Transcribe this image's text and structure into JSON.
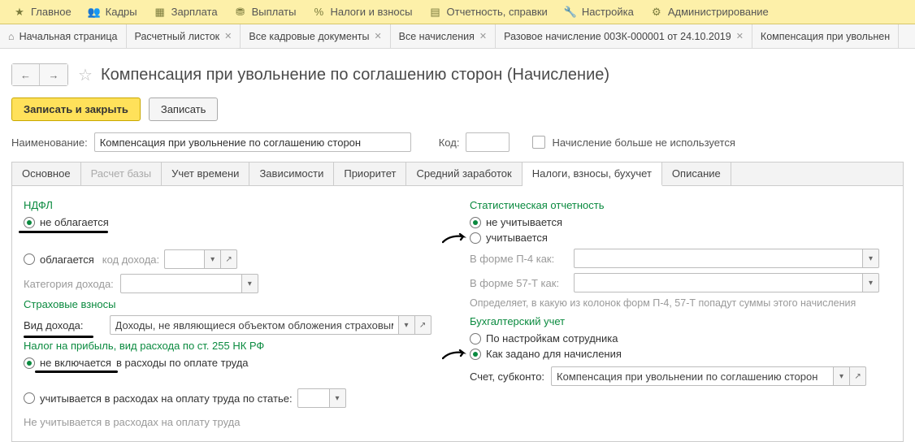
{
  "topmenu": [
    {
      "icon": "star",
      "label": "Главное"
    },
    {
      "icon": "people",
      "label": "Кадры"
    },
    {
      "icon": "calendar",
      "label": "Зарплата"
    },
    {
      "icon": "money",
      "label": "Выплаты"
    },
    {
      "icon": "percent",
      "label": "Налоги и взносы"
    },
    {
      "icon": "doc",
      "label": "Отчетность, справки"
    },
    {
      "icon": "wrench",
      "label": "Настройка"
    },
    {
      "icon": "gear",
      "label": "Администрирование"
    }
  ],
  "tabs_open": [
    {
      "label": "Начальная страница",
      "closable": false,
      "home": true
    },
    {
      "label": "Расчетный листок",
      "closable": true
    },
    {
      "label": "Все кадровые документы",
      "closable": true
    },
    {
      "label": "Все начисления",
      "closable": true
    },
    {
      "label": "Разовое начисление 00ЗК-000001 от 24.10.2019",
      "closable": true
    },
    {
      "label": "Компенсация при увольнен",
      "closable": false
    }
  ],
  "page_title": "Компенсация при увольнение по соглашению сторон (Начисление)",
  "toolbar": {
    "save_close": "Записать и закрыть",
    "save": "Записать"
  },
  "header": {
    "name_label": "Наименование:",
    "name_value": "Компенсация при увольнение по соглашению сторон",
    "code_label": "Код:",
    "code_value": "",
    "not_used_label": "Начисление больше не используется"
  },
  "detail_tabs": [
    "Основное",
    "Расчет базы",
    "Учет времени",
    "Зависимости",
    "Приоритет",
    "Средний заработок",
    "Налоги, взносы, бухучет",
    "Описание"
  ],
  "detail_tabs_active": 6,
  "detail_tabs_disabled": [
    1
  ],
  "left": {
    "ndfl_title": "НДФЛ",
    "ndfl_opt1": "не облагается",
    "ndfl_opt2": "облагается",
    "income_code_label": "код дохода:",
    "income_code_value": "",
    "income_cat_label": "Категория дохода:",
    "income_cat_value": "",
    "ins_title": "Страховые взносы",
    "income_type_label": "Вид дохода:",
    "income_type_value": "Доходы, не являющиеся объектом обложения страховыми в",
    "profit_title": "Налог на прибыль, вид расхода по ст. 255 НК РФ",
    "profit_opt1": "не включается",
    "profit_opt1_suffix": "в расходы по оплате труда",
    "profit_opt2": "учитывается в расходах на оплату труда по статье:",
    "profit_note": "Не учитывается в расходах на оплату труда"
  },
  "right": {
    "stat_title": "Статистическая отчетность",
    "stat_opt1": "не учитывается",
    "stat_opt2": "учитывается",
    "p4_label": "В форме П-4 как:",
    "p4_value": "",
    "p57_label": "В форме 57-Т как:",
    "p57_value": "",
    "stat_desc": "Определяет, в какую из колонок форм П-4, 57-Т попадут суммы этого начисления",
    "acc_title": "Бухгалтерский учет",
    "acc_opt1": "По настройкам сотрудника",
    "acc_opt2": "Как задано для начисления",
    "account_label": "Счет, субконто:",
    "account_value": "Компенсация при увольнении по соглашению сторон"
  }
}
